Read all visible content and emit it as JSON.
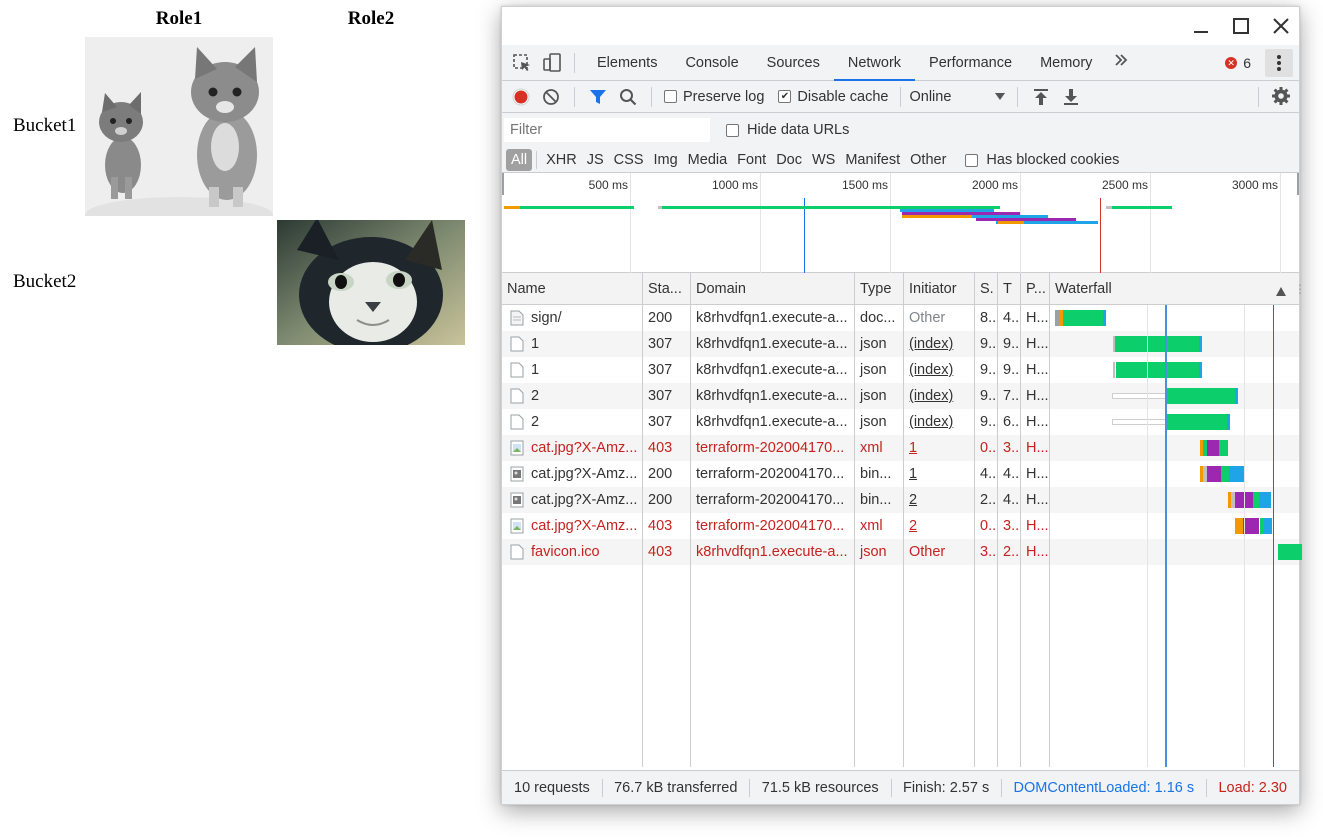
{
  "page": {
    "col_headers": [
      "Role1",
      "Role2"
    ],
    "row_labels": [
      "Bucket1",
      "Bucket2"
    ]
  },
  "devtools": {
    "tabs": [
      "Elements",
      "Console",
      "Sources",
      "Network",
      "Performance",
      "Memory"
    ],
    "active_tab": "Network",
    "more_tabs_icon": "double-chevron-right-icon",
    "error_count": "6",
    "toolbar": {
      "preserve_log": "Preserve log",
      "disable_cache": "Disable cache",
      "throttling": "Online"
    },
    "filter": {
      "placeholder": "Filter",
      "hide_data_urls": "Hide data URLs",
      "types": [
        "All",
        "XHR",
        "JS",
        "CSS",
        "Img",
        "Media",
        "Font",
        "Doc",
        "WS",
        "Manifest",
        "Other"
      ],
      "has_blocked_cookies": "Has blocked cookies"
    },
    "overview_ticks": [
      "500 ms",
      "1000 ms",
      "1500 ms",
      "2000 ms",
      "2500 ms",
      "3000 ms"
    ],
    "columns": [
      "Name",
      "Sta...",
      "Domain",
      "Type",
      "Initiator",
      "S.",
      "T",
      "P...",
      "Waterfall"
    ],
    "rows": [
      {
        "name": "sign/",
        "status": "200",
        "domain": "k8rhvdfqn1.execute-a...",
        "type": "doc...",
        "initiator": "Other",
        "size": "8...",
        "time": "4...",
        "proto": "H...",
        "error": false,
        "icon": "document-icon"
      },
      {
        "name": "1",
        "status": "307",
        "domain": "k8rhvdfqn1.execute-a...",
        "type": "json",
        "initiator": "(index)",
        "size": "9...",
        "time": "9...",
        "proto": "H...",
        "error": false,
        "icon": "file-icon"
      },
      {
        "name": "1",
        "status": "307",
        "domain": "k8rhvdfqn1.execute-a...",
        "type": "json",
        "initiator": "(index)",
        "size": "9...",
        "time": "9...",
        "proto": "H...",
        "error": false,
        "icon": "file-icon"
      },
      {
        "name": "2",
        "status": "307",
        "domain": "k8rhvdfqn1.execute-a...",
        "type": "json",
        "initiator": "(index)",
        "size": "9...",
        "time": "7...",
        "proto": "H...",
        "error": false,
        "icon": "file-icon"
      },
      {
        "name": "2",
        "status": "307",
        "domain": "k8rhvdfqn1.execute-a...",
        "type": "json",
        "initiator": "(index)",
        "size": "9...",
        "time": "6...",
        "proto": "H...",
        "error": false,
        "icon": "file-icon"
      },
      {
        "name": "cat.jpg?X-Amz...",
        "status": "403",
        "domain": "terraform-202004170...",
        "type": "xml",
        "initiator": "1",
        "size": "0...",
        "time": "3...",
        "proto": "H...",
        "error": true,
        "icon": "broken-image-icon"
      },
      {
        "name": "cat.jpg?X-Amz...",
        "status": "200",
        "domain": "terraform-202004170...",
        "type": "bin...",
        "initiator": "1",
        "size": "4...",
        "time": "4...",
        "proto": "H...",
        "error": false,
        "icon": "image-thumb-icon"
      },
      {
        "name": "cat.jpg?X-Amz...",
        "status": "200",
        "domain": "terraform-202004170...",
        "type": "bin...",
        "initiator": "2",
        "size": "2...",
        "time": "4...",
        "proto": "H...",
        "error": false,
        "icon": "image-thumb-icon"
      },
      {
        "name": "cat.jpg?X-Amz...",
        "status": "403",
        "domain": "terraform-202004170...",
        "type": "xml",
        "initiator": "2",
        "size": "0...",
        "time": "3...",
        "proto": "H...",
        "error": true,
        "icon": "broken-image-icon"
      },
      {
        "name": "favicon.ico",
        "status": "403",
        "domain": "k8rhvdfqn1.execute-a...",
        "type": "json",
        "initiator": "Other",
        "size": "3...",
        "time": "2...",
        "proto": "H...",
        "error": true,
        "icon": "file-icon"
      }
    ],
    "status": {
      "requests": "10 requests",
      "transferred": "76.7 kB transferred",
      "resources": "71.5 kB resources",
      "finish": "Finish: 2.57 s",
      "dom_content_loaded": "DOMContentLoaded: 1.16 s",
      "load": "Load: 2.30"
    },
    "colors": {
      "accent": "#1a73e8",
      "error": "#c5221f",
      "dcl_line": "#1a73e8",
      "load_line": "#d93025",
      "bar_green": "#0cce6b",
      "bar_blue": "#20a4e8",
      "bar_purple": "#9c27b0",
      "bar_orange": "#f29900"
    }
  }
}
